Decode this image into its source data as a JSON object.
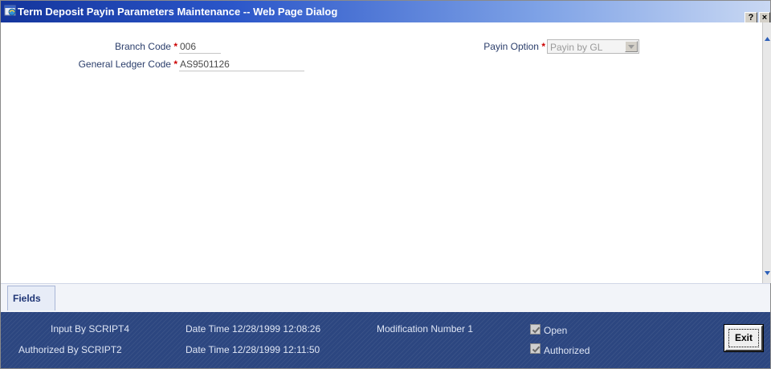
{
  "window": {
    "title": "Term Deposit Payin Parameters Maintenance -- Web Page Dialog",
    "help_label": "?",
    "close_label": "×"
  },
  "form": {
    "branch_code": {
      "label": "Branch Code",
      "required_mark": "*",
      "value": "006"
    },
    "gl_code": {
      "label": "General Ledger Code",
      "required_mark": "*",
      "value": "AS9501126"
    },
    "payin_option": {
      "label": "Payin Option",
      "required_mark": "*",
      "value": "Payin by GL"
    }
  },
  "tabs": {
    "fields_label": "Fields"
  },
  "audit": {
    "input_by": "Input By SCRIPT4",
    "input_datetime": "Date Time 12/28/1999 12:08:26",
    "modification_number": "Modification Number 1",
    "authorized_by": "Authorized By SCRIPT2",
    "auth_datetime": "Date Time 12/28/1999 12:11:50",
    "open_label": "Open",
    "open_checked": true,
    "authorized_label": "Authorized",
    "authorized_checked": true
  },
  "buttons": {
    "exit_label": "Exit"
  },
  "colors": {
    "title_bar_start": "#14359c",
    "footer_bg": "#2c4680",
    "required_mark": "#cc0000",
    "label_text": "#2b3e6b"
  }
}
